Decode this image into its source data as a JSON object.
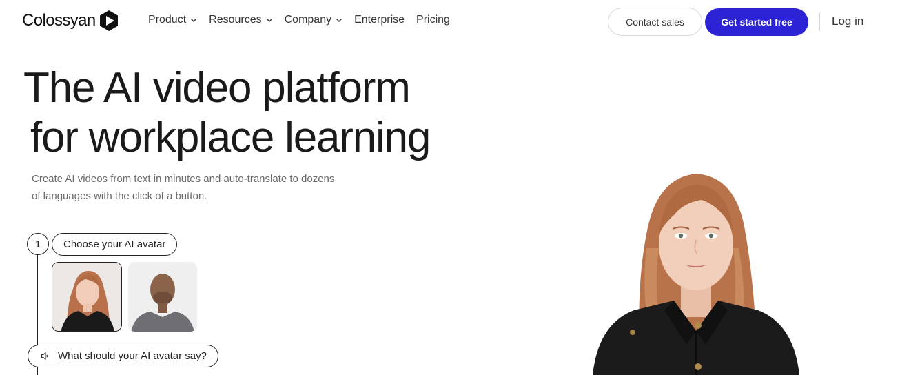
{
  "brand": {
    "name": "Colossyan",
    "accent": "#2c24d4"
  },
  "nav": {
    "links": [
      {
        "label": "Product",
        "has_dropdown": true
      },
      {
        "label": "Resources",
        "has_dropdown": true
      },
      {
        "label": "Company",
        "has_dropdown": true
      },
      {
        "label": "Enterprise",
        "has_dropdown": false
      },
      {
        "label": "Pricing",
        "has_dropdown": false
      }
    ],
    "contact_label": "Contact sales",
    "start_label": "Get started free",
    "login_label": "Log in"
  },
  "hero": {
    "title_line1": "The AI video platform",
    "title_line2": "for workplace learning",
    "subtitle": "Create AI videos from text in minutes and auto-translate to dozens of languages with the click of a button."
  },
  "steps": {
    "step1_number": "1",
    "step1_label": "Choose your AI avatar",
    "step2_label": "What should your AI avatar say?",
    "avatars": [
      "woman-avatar",
      "man-avatar"
    ]
  }
}
